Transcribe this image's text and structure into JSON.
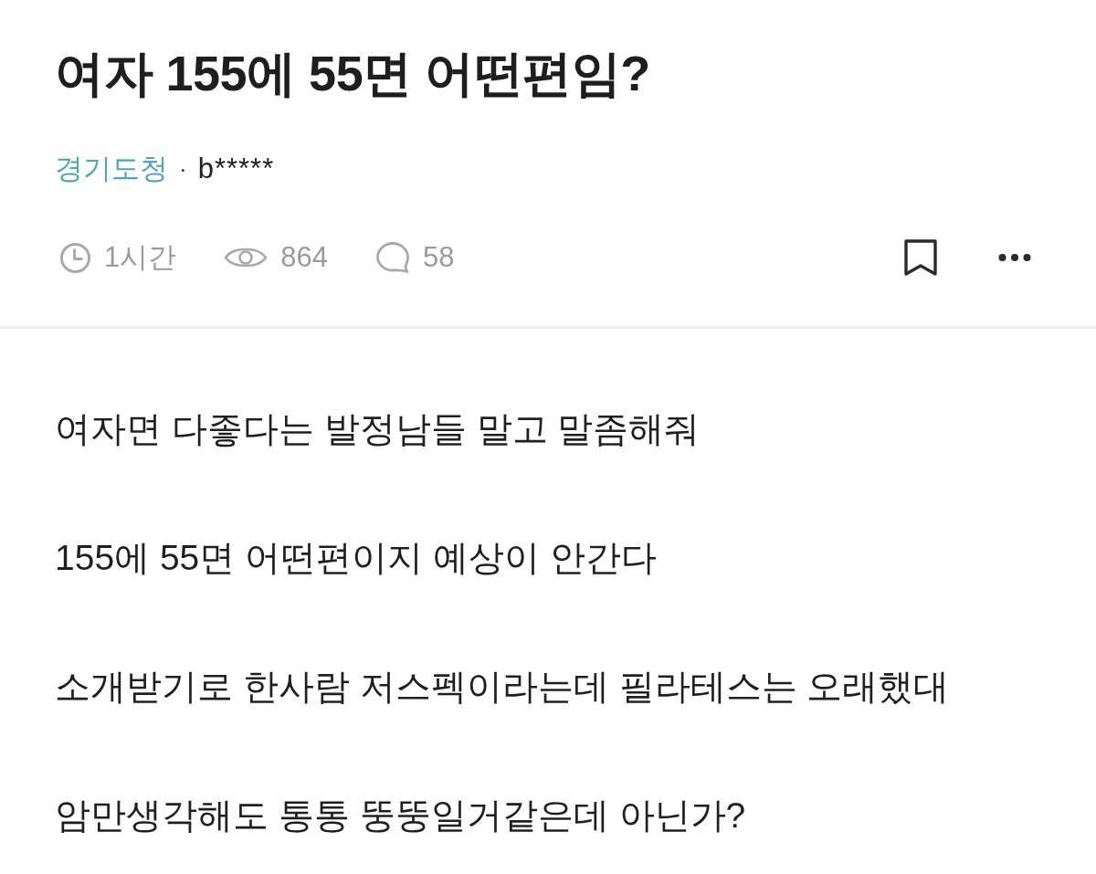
{
  "post": {
    "title": "여자 155에 55면 어떤편임?",
    "board": "경기도청",
    "separator": "·",
    "author": "b*****",
    "stats": [
      {
        "kind": "time",
        "text": "1시간"
      },
      {
        "kind": "views",
        "text": "864"
      },
      {
        "kind": "comments",
        "text": "58"
      }
    ],
    "bookmarked": false
  },
  "body": [
    "여자면 다좋다는 발정남들 말고 말좀해줘",
    "155에 55면 어떤편이지 예상이 안간다",
    "소개받기로 한사람 저스펙이라는데 필라테스는 오래했대",
    "암만생각해도 통통 뚱뚱일거같은데 아닌가?"
  ]
}
